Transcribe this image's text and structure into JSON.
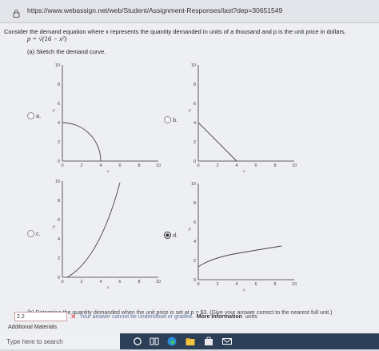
{
  "browser": {
    "url": "https://www.webassign.net/web/Student/Assignment-Responses/last?dep=30651549"
  },
  "question": {
    "text": "Consider the demand equation where x represents the quantity demanded in units of a thousand and p is the unit price in dollars.",
    "equation": "p = √(16 − x²)",
    "part_a": "(a) Sketch the demand curve."
  },
  "options": [
    {
      "label": "a.",
      "selected": false
    },
    {
      "label": "b.",
      "selected": false
    },
    {
      "label": "c.",
      "selected": false
    },
    {
      "label": "d.",
      "selected": true
    }
  ],
  "graphs": {
    "y_label": "p",
    "x_label": "x",
    "x_ticks": [
      "0",
      "2",
      "4",
      "6",
      "8",
      "10"
    ],
    "y_ticks": [
      "0",
      "2",
      "4",
      "6",
      "8",
      "10"
    ]
  },
  "part_b": {
    "text": "(b) Determine the quantity demanded when the unit price is set at p = $3. (Give your answer correct to the nearest full unit.)",
    "answer": "2.2",
    "feedback": "Your answer cannot be understood or graded.",
    "more_info": "More Information",
    "units": "units"
  },
  "additional_materials": "Additional Materials",
  "taskbar": {
    "search_placeholder": "Type here to search"
  }
}
